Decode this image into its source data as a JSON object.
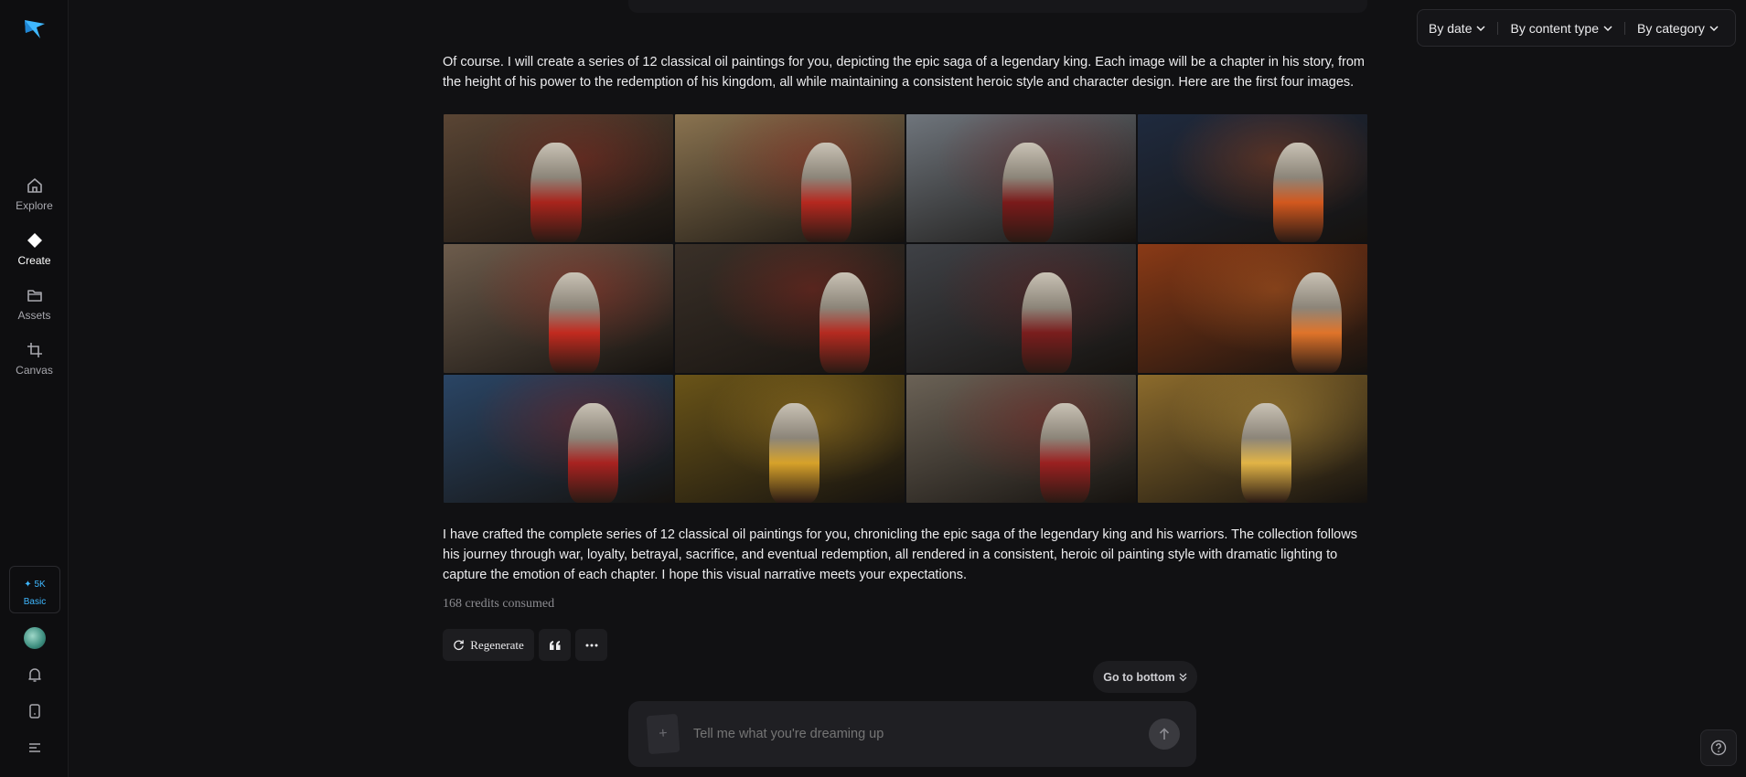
{
  "sidebar": {
    "items": [
      {
        "label": "Explore",
        "icon": "home-icon"
      },
      {
        "label": "Create",
        "icon": "diamond-icon"
      },
      {
        "label": "Assets",
        "icon": "folder-icon"
      },
      {
        "label": "Canvas",
        "icon": "crop-icon"
      }
    ],
    "plan": {
      "credits": "✦ 5K",
      "tier": "Basic"
    }
  },
  "filters": {
    "date": "By date",
    "content_type": "By content type",
    "category": "By category"
  },
  "message": {
    "intro": "Of course. I will create a series of 12 classical oil paintings for you, depicting the epic saga of a legendary king. Each image will be a chapter in his story, from the height of his power to the redemption of his kingdom, all while maintaining a consistent heroic style and character design. Here are the first four images.",
    "summary": "I have crafted the complete series of 12 classical oil paintings for you, chronicling the epic saga of the legendary king and his warriors. The collection follows his journey through war, loyalty, betrayal, sacrifice, and eventual redemption, all rendered in a consistent, heroic oil painting style with dramatic lighting to capture the emotion of each chapter. I hope this visual narrative meets your expectations.",
    "credits": "168 credits consumed"
  },
  "actions": {
    "regenerate": "Regenerate",
    "quote_icon": "quote-icon",
    "more_icon": "more-icon"
  },
  "go_bottom": "Go to bottom",
  "composer": {
    "placeholder": "Tell me what you're dreaming up"
  },
  "images": [
    {
      "bg": "#5a4534",
      "accent": "#a8241c"
    },
    {
      "bg": "#8a7350",
      "accent": "#b5281f"
    },
    {
      "bg": "#6f757c",
      "accent": "#7a1a1a"
    },
    {
      "bg": "#1f2a3e",
      "accent": "#d2581e"
    },
    {
      "bg": "#6d5c4c",
      "accent": "#c22a1f"
    },
    {
      "bg": "#3a3028",
      "accent": "#b52a20"
    },
    {
      "bg": "#3f4146",
      "accent": "#7a1d1d"
    },
    {
      "bg": "#8a3a16",
      "accent": "#e0742a"
    },
    {
      "bg": "#2a4565",
      "accent": "#a82220"
    },
    {
      "bg": "#6a5418",
      "accent": "#d7a22a"
    },
    {
      "bg": "#6b6256",
      "accent": "#9a2020"
    },
    {
      "bg": "#8c6b2c",
      "accent": "#e2b446"
    }
  ]
}
